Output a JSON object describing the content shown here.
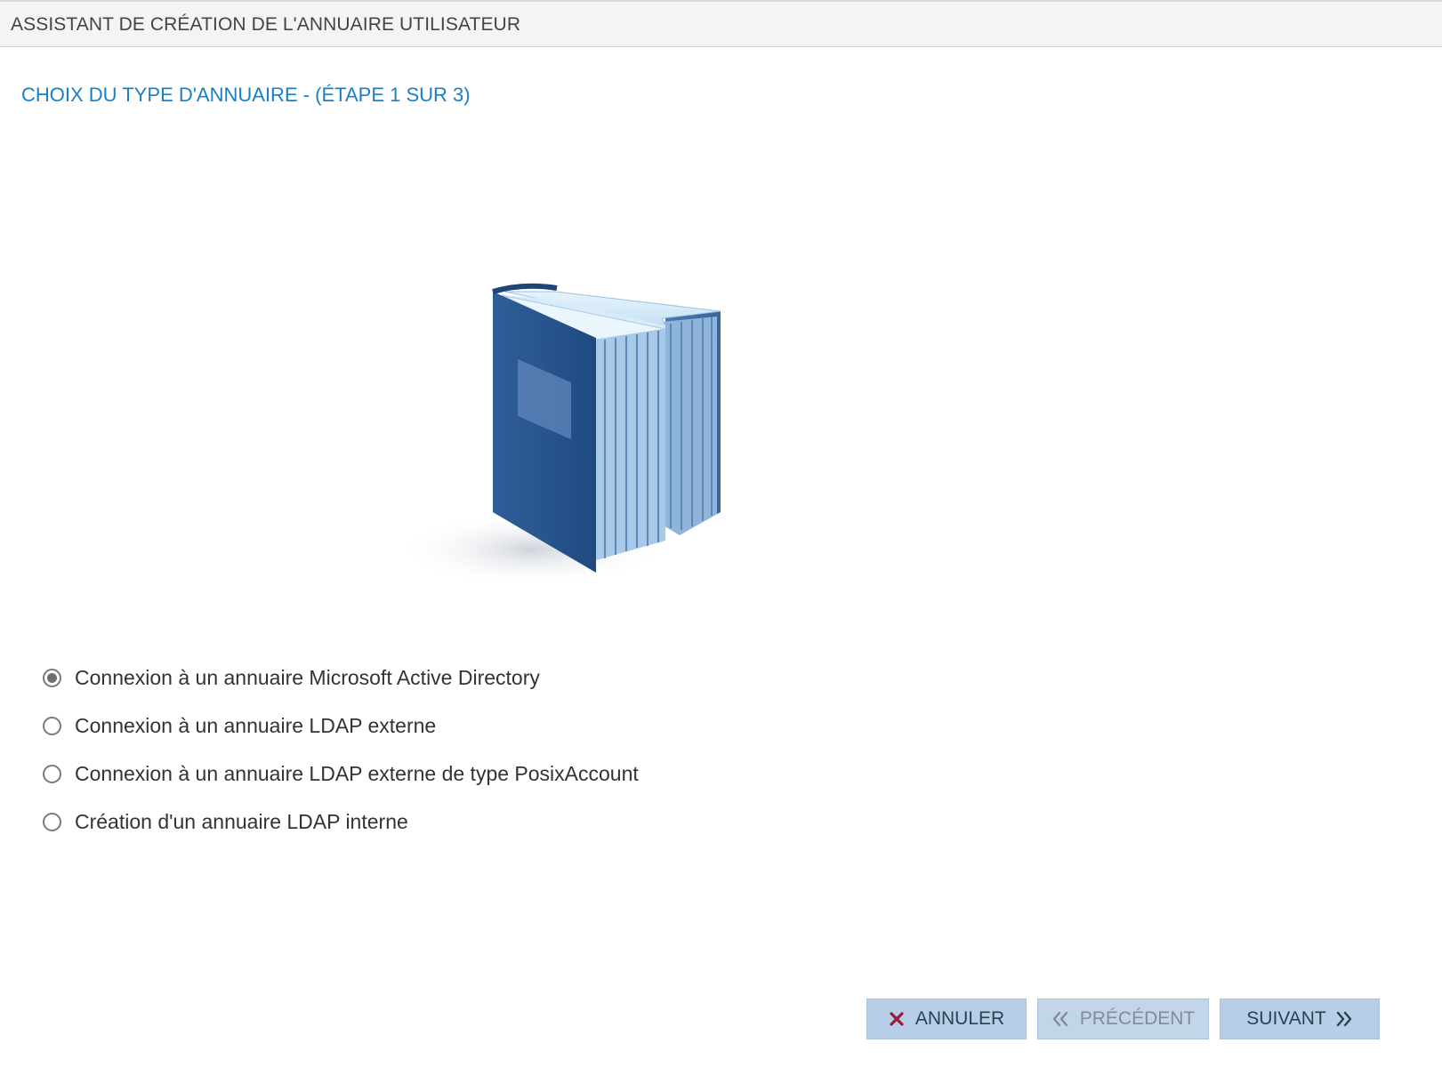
{
  "window": {
    "title": "ASSISTANT DE CRÉATION DE L'ANNUAIRE UTILISATEUR"
  },
  "step": {
    "title": "CHOIX DU TYPE D'ANNUAIRE - (ÉTAPE 1 SUR 3)"
  },
  "illustration": {
    "icon": "book-icon"
  },
  "options": [
    {
      "label": "Connexion à un annuaire Microsoft Active Directory",
      "checked": true
    },
    {
      "label": "Connexion à un annuaire LDAP externe",
      "checked": false
    },
    {
      "label": "Connexion à un annuaire LDAP externe de type PosixAccount",
      "checked": false
    },
    {
      "label": "Création d'un annuaire LDAP interne",
      "checked": false
    }
  ],
  "buttons": {
    "cancel": {
      "label": "ANNULER",
      "icon": "close-icon",
      "enabled": true
    },
    "previous": {
      "label": "PRÉCÉDENT",
      "icon": "double-chevron-left-icon",
      "enabled": false
    },
    "next": {
      "label": "SUIVANT",
      "icon": "double-chevron-right-icon",
      "enabled": true
    }
  },
  "colors": {
    "accent": "#1a7fc4",
    "button_bg": "#b7cfe6",
    "cancel_icon": "#9b1b3a"
  }
}
